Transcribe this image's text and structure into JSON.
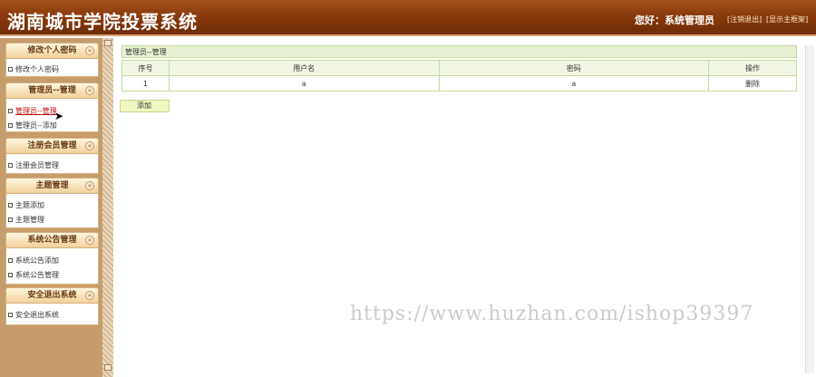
{
  "header": {
    "title": "湖南城市学院投票系统",
    "greeting": "您好：系统管理员",
    "links": [
      "[注销退出]",
      "[显示主框架]"
    ]
  },
  "sidebar": {
    "groups": [
      {
        "title": "修改个人密码",
        "items": [
          "修改个人密码"
        ]
      },
      {
        "title": "管理员--管理",
        "items": [
          "管理员--管理",
          "管理员--添加"
        ]
      },
      {
        "title": "注册会员管理",
        "items": [
          "注册会员管理"
        ]
      },
      {
        "title": "主题管理",
        "items": [
          "主题添加",
          "主题管理"
        ]
      },
      {
        "title": "系统公告管理",
        "items": [
          "系统公告添加",
          "系统公告管理"
        ]
      },
      {
        "title": "安全退出系统",
        "items": [
          "安全退出系统"
        ]
      }
    ],
    "collapse_glyph": "«"
  },
  "main": {
    "panel_title": "管理员--管理",
    "table": {
      "headers": [
        "序号",
        "用户名",
        "密码",
        "操作"
      ],
      "rows": [
        [
          "1",
          "a",
          "a",
          "删除"
        ]
      ]
    },
    "add_button": "添加"
  },
  "watermark": "https://www.huzhan.com/ishop39397",
  "colors": {
    "header_bg": "#8a3b0c",
    "sidebar_bg": "#c79c6c",
    "panel_border": "#c6d9a0",
    "add_button_bg": "#f0f7c2",
    "active_link": "#c41010"
  }
}
